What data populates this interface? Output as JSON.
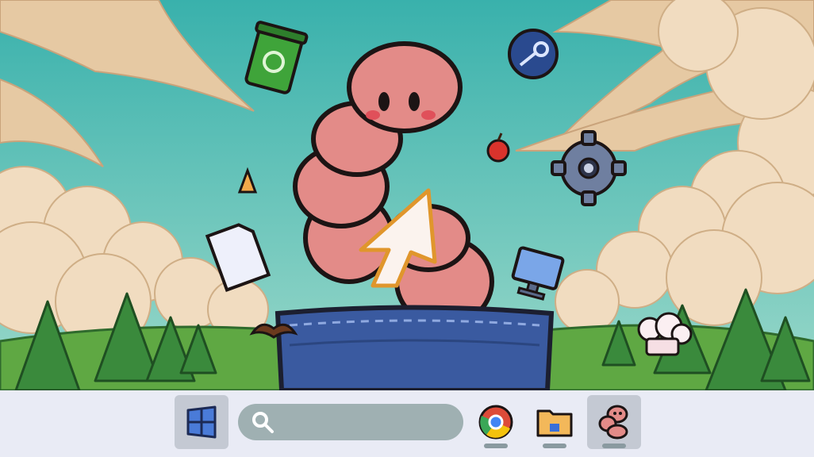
{
  "colors": {
    "sky_top": "#3fb8b0",
    "sky_bottom": "#8fd6c8",
    "cloud": "#f0dcc0",
    "cloud_shadow": "#d7b890",
    "tree": "#3a8a3c",
    "grass": "#5fa843",
    "worm": "#e38b88",
    "worm_dark": "#c96763",
    "pocket": "#3a5aa0",
    "taskbar": "#e9ebf5",
    "taskbar_active": "#c4c9d3",
    "search_bg": "#9fb0b2"
  },
  "desktop": {
    "icons": [
      "recycle-bin",
      "steam",
      "apple",
      "settings-gear",
      "candy-corn",
      "document",
      "monitor",
      "cursor-arrow",
      "mustache",
      "chef-hat"
    ]
  },
  "taskbar": {
    "start_icon": "windows-start-icon",
    "search": {
      "placeholder": "",
      "value": ""
    },
    "pinned_apps": [
      {
        "name": "chrome",
        "icon": "chrome-icon",
        "running": true
      },
      {
        "name": "file-explorer",
        "icon": "folder-icon",
        "running": true
      },
      {
        "name": "worm-app",
        "icon": "worm-icon",
        "running": true,
        "active": true
      }
    ]
  }
}
